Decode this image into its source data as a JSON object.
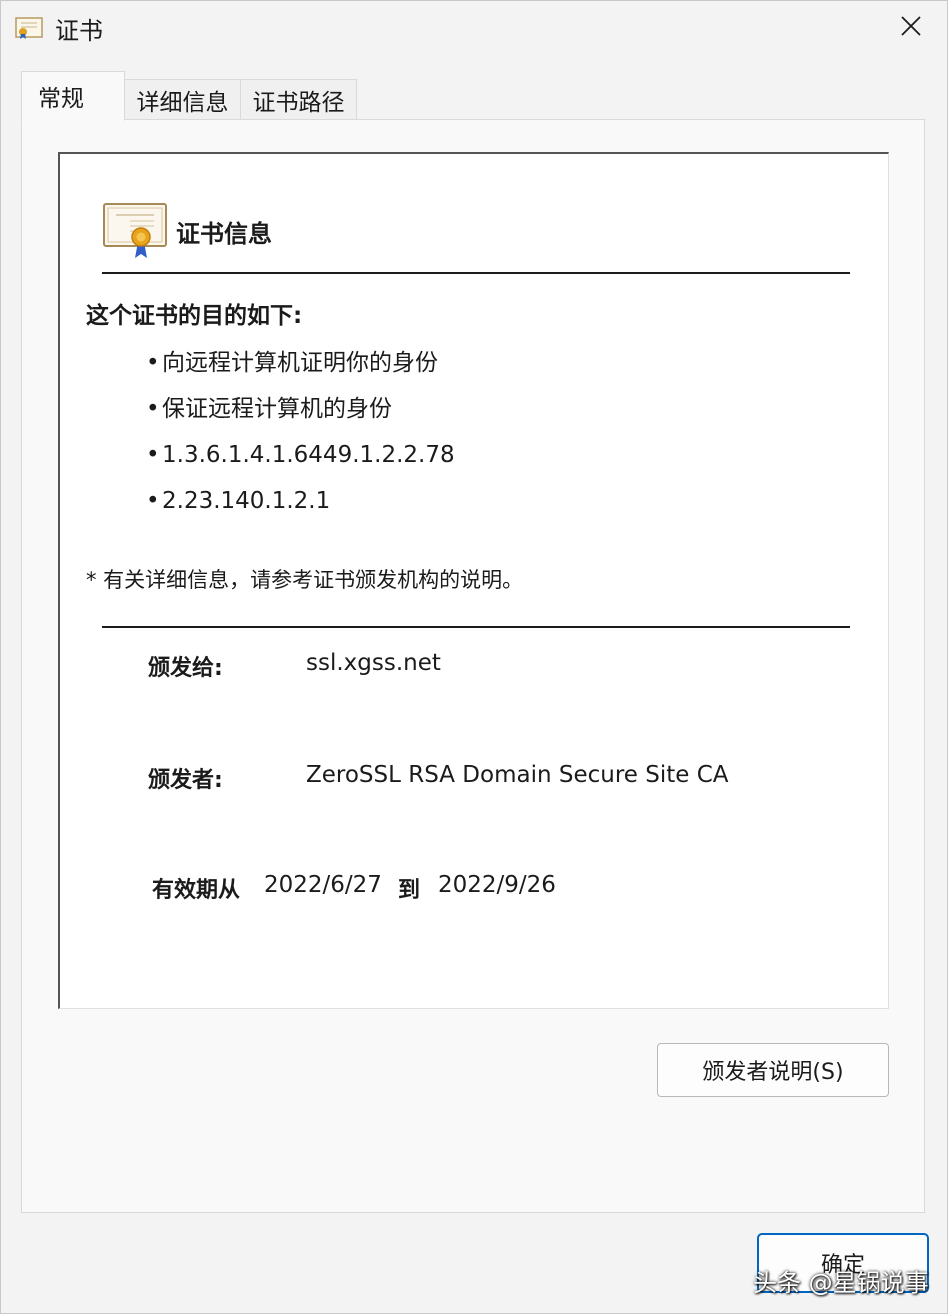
{
  "window": {
    "title": "证书"
  },
  "tabs": [
    {
      "label": "常规",
      "active": true
    },
    {
      "label": "详细信息",
      "active": false
    },
    {
      "label": "证书路径",
      "active": false
    }
  ],
  "cert_info": {
    "header": "证书信息",
    "purpose_title": "这个证书的目的如下:",
    "purposes": [
      "向远程计算机证明你的身份",
      "保证远程计算机的身份",
      "1.3.6.1.4.1.6449.1.2.2.78",
      "2.23.140.1.2.1"
    ],
    "note": "* 有关详细信息，请参考证书颁发机构的说明。",
    "issued_to_label": "颁发给:",
    "issued_to_value": "ssl.xgss.net",
    "issued_by_label": "颁发者:",
    "issued_by_value": "ZeroSSL RSA Domain Secure Site CA",
    "valid_from_label": "有效期从",
    "valid_from_value": "2022/6/27",
    "valid_to_label": "到",
    "valid_to_value": "2022/9/26"
  },
  "buttons": {
    "issuer_statement": "颁发者说明(S)",
    "ok": "确定"
  },
  "watermark": "头条 @星锅说事",
  "icons": {
    "title": "certificate-icon",
    "close": "close-icon",
    "cert": "certificate-icon"
  }
}
